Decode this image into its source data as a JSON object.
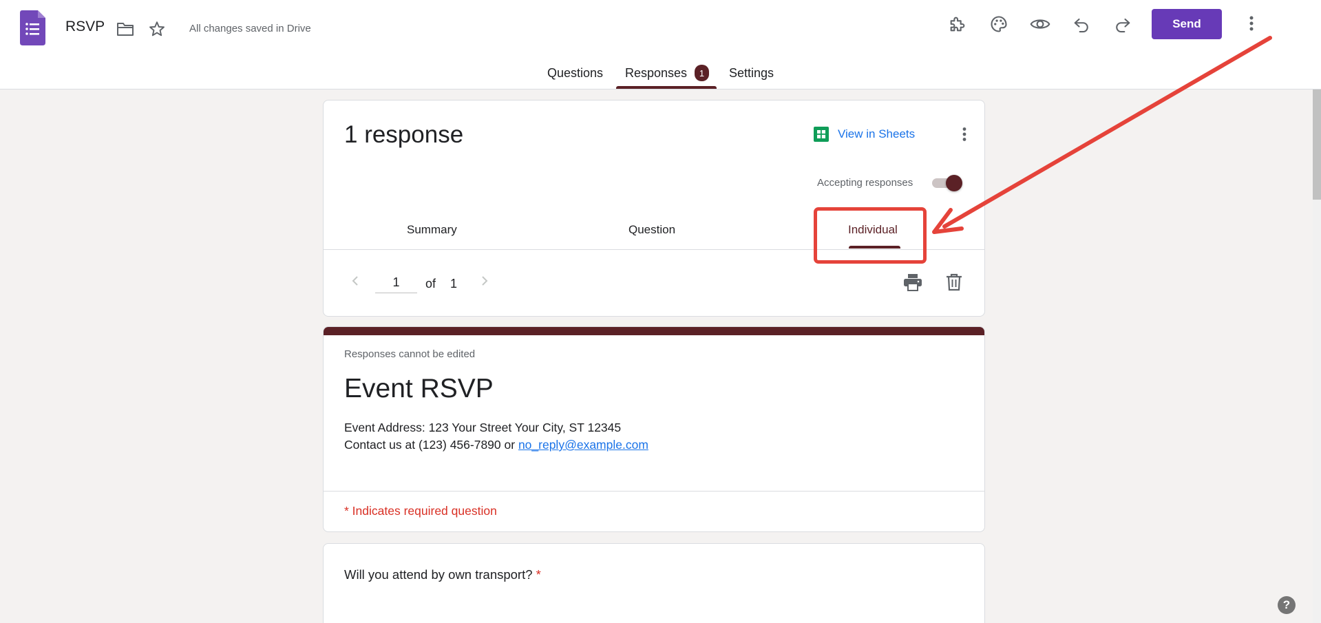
{
  "header": {
    "doc_title": "RSVP",
    "save_status": "All changes saved in Drive",
    "send_label": "Send",
    "icons": [
      "forms-logo-icon",
      "folder-icon",
      "star-icon",
      "addon-puzzle-icon",
      "palette-icon",
      "preview-eye-icon",
      "undo-icon",
      "redo-icon",
      "more-vert-icon"
    ]
  },
  "main_tabs": {
    "questions": "Questions",
    "responses": "Responses",
    "responses_badge": "1",
    "settings": "Settings",
    "active": "Responses"
  },
  "responses_card": {
    "count_label": "1 response",
    "view_in_sheets": "View in Sheets",
    "accepting_label": "Accepting responses",
    "accepting_on": true,
    "sub_tabs": {
      "summary": "Summary",
      "question": "Question",
      "individual": "Individual",
      "active": "Individual"
    },
    "pager": {
      "current": "1",
      "of_label": "of",
      "total": "1"
    }
  },
  "form": {
    "not_editable_note": "Responses cannot be edited",
    "title": "Event RSVP",
    "address_line": "Event Address: 123 Your Street Your City, ST 12345",
    "contact_prefix": "Contact us at (123) 456-7890 or ",
    "contact_email": "no_reply@example.com",
    "required_note": "* Indicates required question",
    "questions": [
      {
        "text": "Will you attend by own transport?",
        "required_mark": "*"
      }
    ]
  },
  "help_label": "?",
  "colors": {
    "brand_purple": "#673ab7",
    "theme_maroon": "#5b2126",
    "link_blue": "#1a73e8",
    "required_red": "#d93025",
    "annotation_red": "#e5433a",
    "sheets_green": "#0f9d58"
  }
}
